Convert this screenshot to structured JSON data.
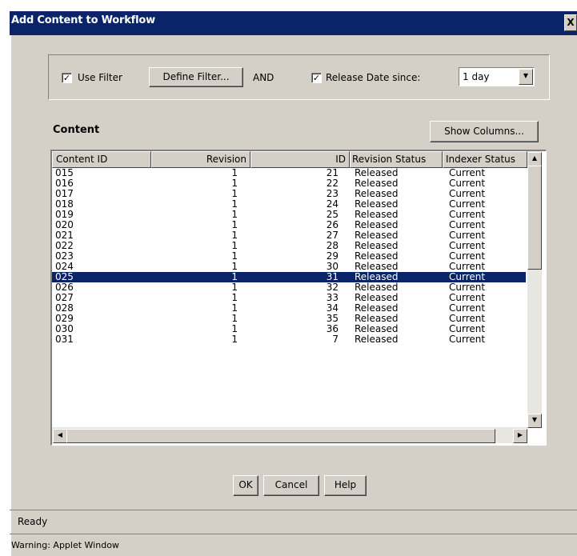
{
  "window": {
    "title": "Add Content to Workflow",
    "close_label": "X"
  },
  "filter": {
    "use_filter_label": "Use Filter",
    "use_filter_checked": true,
    "define_filter_label": "Define Filter...",
    "and_label": "AND",
    "release_date_label": "Release Date since:",
    "release_date_checked": true,
    "release_date_value": "1 day"
  },
  "content": {
    "heading": "Content",
    "show_columns_label": "Show Columns...",
    "columns": [
      "Content ID",
      "Revision",
      "ID",
      "Revision Status",
      "Indexer Status"
    ],
    "rows": [
      {
        "content_id": "015",
        "revision": "1",
        "id": "21",
        "revision_status": "Released",
        "indexer_status": "Current"
      },
      {
        "content_id": "016",
        "revision": "1",
        "id": "22",
        "revision_status": "Released",
        "indexer_status": "Current"
      },
      {
        "content_id": "017",
        "revision": "1",
        "id": "23",
        "revision_status": "Released",
        "indexer_status": "Current"
      },
      {
        "content_id": "018",
        "revision": "1",
        "id": "24",
        "revision_status": "Released",
        "indexer_status": "Current"
      },
      {
        "content_id": "019",
        "revision": "1",
        "id": "25",
        "revision_status": "Released",
        "indexer_status": "Current"
      },
      {
        "content_id": "020",
        "revision": "1",
        "id": "26",
        "revision_status": "Released",
        "indexer_status": "Current"
      },
      {
        "content_id": "021",
        "revision": "1",
        "id": "27",
        "revision_status": "Released",
        "indexer_status": "Current"
      },
      {
        "content_id": "022",
        "revision": "1",
        "id": "28",
        "revision_status": "Released",
        "indexer_status": "Current"
      },
      {
        "content_id": "023",
        "revision": "1",
        "id": "29",
        "revision_status": "Released",
        "indexer_status": "Current"
      },
      {
        "content_id": "024",
        "revision": "1",
        "id": "30",
        "revision_status": "Released",
        "indexer_status": "Current"
      },
      {
        "content_id": "025",
        "revision": "1",
        "id": "31",
        "revision_status": "Released",
        "indexer_status": "Current"
      },
      {
        "content_id": "026",
        "revision": "1",
        "id": "32",
        "revision_status": "Released",
        "indexer_status": "Current"
      },
      {
        "content_id": "027",
        "revision": "1",
        "id": "33",
        "revision_status": "Released",
        "indexer_status": "Current"
      },
      {
        "content_id": "028",
        "revision": "1",
        "id": "34",
        "revision_status": "Released",
        "indexer_status": "Current"
      },
      {
        "content_id": "029",
        "revision": "1",
        "id": "35",
        "revision_status": "Released",
        "indexer_status": "Current"
      },
      {
        "content_id": "030",
        "revision": "1",
        "id": "36",
        "revision_status": "Released",
        "indexer_status": "Current"
      },
      {
        "content_id": "031",
        "revision": "1",
        "id": "7",
        "revision_status": "Released",
        "indexer_status": "Current"
      }
    ],
    "selected_index": 10
  },
  "buttons": {
    "ok_label": "OK",
    "cancel_label": "Cancel",
    "help_label": "Help"
  },
  "status": {
    "text": "Ready",
    "warning": "Warning: Applet Window"
  },
  "colors": {
    "face": "#d4d0c8",
    "title_bar": "#0a246a",
    "selection": "#0a246a"
  },
  "icons": {
    "scroll_up": "up-arrow-icon",
    "scroll_down": "down-arrow-icon",
    "scroll_left": "left-arrow-icon",
    "scroll_right": "right-arrow-icon",
    "combo": "down-arrow-icon"
  }
}
